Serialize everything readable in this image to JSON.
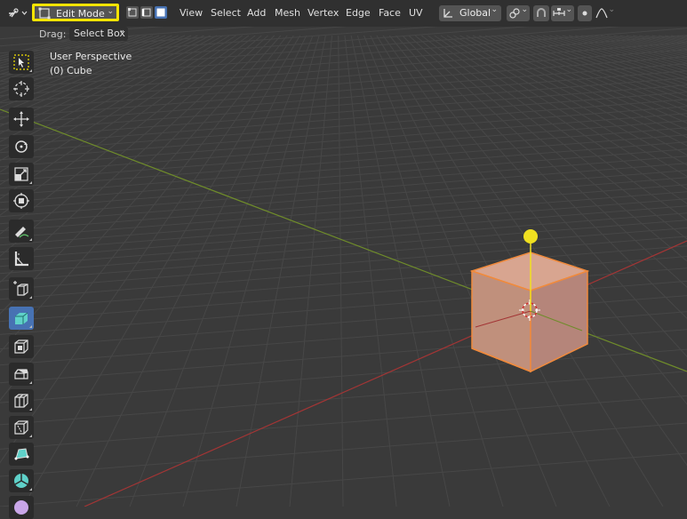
{
  "header": {
    "mode_label": "Edit Mode",
    "menus": [
      "View",
      "Select",
      "Add",
      "Mesh",
      "Vertex",
      "Edge",
      "Face",
      "UV"
    ],
    "transform_orientation": "Global"
  },
  "tool_header": {
    "drag_label": "Drag:",
    "drag_value": "Select Box"
  },
  "viewport": {
    "perspective_label": "User Perspective",
    "object_label": "(0) Cube"
  },
  "colors": {
    "mode_highlight": "#f6e400",
    "active_blue": "#4772b3",
    "cube_fill": "#c89580",
    "cube_edge": "#f08a3c",
    "axis_x": "#b23a3a",
    "axis_y": "#7a9a2e",
    "gizmo_yellow": "#f0e020"
  }
}
